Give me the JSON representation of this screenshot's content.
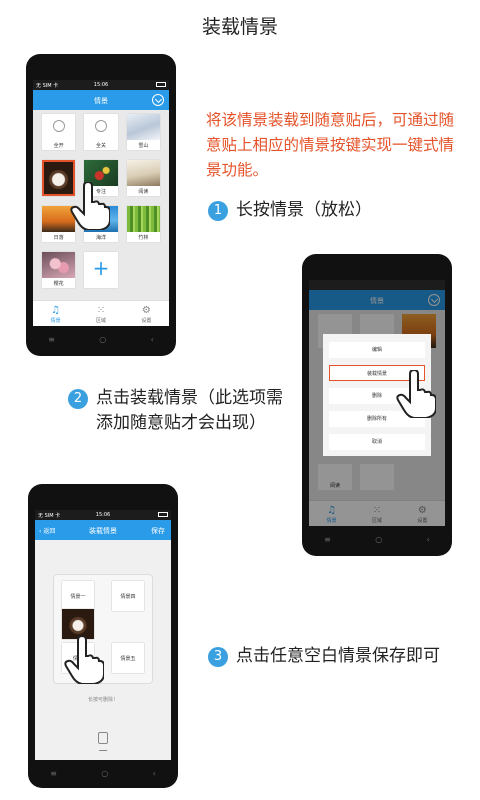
{
  "guide": {
    "title": "装载情景",
    "red_note": "将该情景装载到随意贴后，可通过随意贴上相应的情景按键实现一键式情景功能。",
    "step1": {
      "badge": "1",
      "text": "长按情景（放松）"
    },
    "step2": {
      "badge": "2",
      "text": "点击装载情景（此选项需添加随意贴才会出现）"
    },
    "step3": {
      "badge": "3",
      "text": "点击任意空白情景保存即可"
    }
  },
  "colors": {
    "accent_blue": "#2a9be8",
    "note_red": "#e5532a",
    "badge_blue": "#3aa0e0"
  },
  "phone1": {
    "status": {
      "carrier": "无 SIM 卡",
      "time": "15:06"
    },
    "header_title": "情景",
    "tiles": [
      {
        "label": "全开",
        "icon": "bulb-icon"
      },
      {
        "label": "全关",
        "icon": "bulb-icon"
      },
      {
        "label": "雪山",
        "icon": "snow-image"
      },
      {
        "label": "",
        "icon": "coffee-image"
      },
      {
        "label": "专注",
        "icon": "chess-image"
      },
      {
        "label": "阅读",
        "icon": "book-image"
      },
      {
        "label": "日落",
        "icon": "sunset-image"
      },
      {
        "label": "海洋",
        "icon": "ocean-image"
      },
      {
        "label": "竹林",
        "icon": "bamboo-image"
      },
      {
        "label": "樱花",
        "icon": "blossom-image"
      },
      {
        "label": "",
        "icon": "plus-icon"
      }
    ],
    "tabs": [
      {
        "label": "情景",
        "icon": "music-icon"
      },
      {
        "label": "区域",
        "icon": "grid-icon"
      },
      {
        "label": "设置",
        "icon": "gear-icon"
      }
    ]
  },
  "phone2": {
    "header_title": "情景",
    "menu": [
      "编辑",
      "装载情景",
      "删除",
      "删除所有",
      "取消"
    ],
    "menu_selected_index": 1,
    "bg_tile_label": "阅读",
    "tabs": [
      {
        "label": "情景",
        "icon": "music-icon"
      },
      {
        "label": "区域",
        "icon": "grid-icon"
      },
      {
        "label": "设置",
        "icon": "gear-icon"
      }
    ]
  },
  "phone3": {
    "status": {
      "carrier": "无 SIM 卡",
      "time": "15:06"
    },
    "back_label": "返回",
    "header_title": "装载情景",
    "save_label": "保存",
    "slots": [
      "情景一",
      "情景四",
      "情景",
      "情景五"
    ],
    "hint": "长按可删除！"
  },
  "nav_keys": [
    "≡",
    "○",
    "‹"
  ]
}
